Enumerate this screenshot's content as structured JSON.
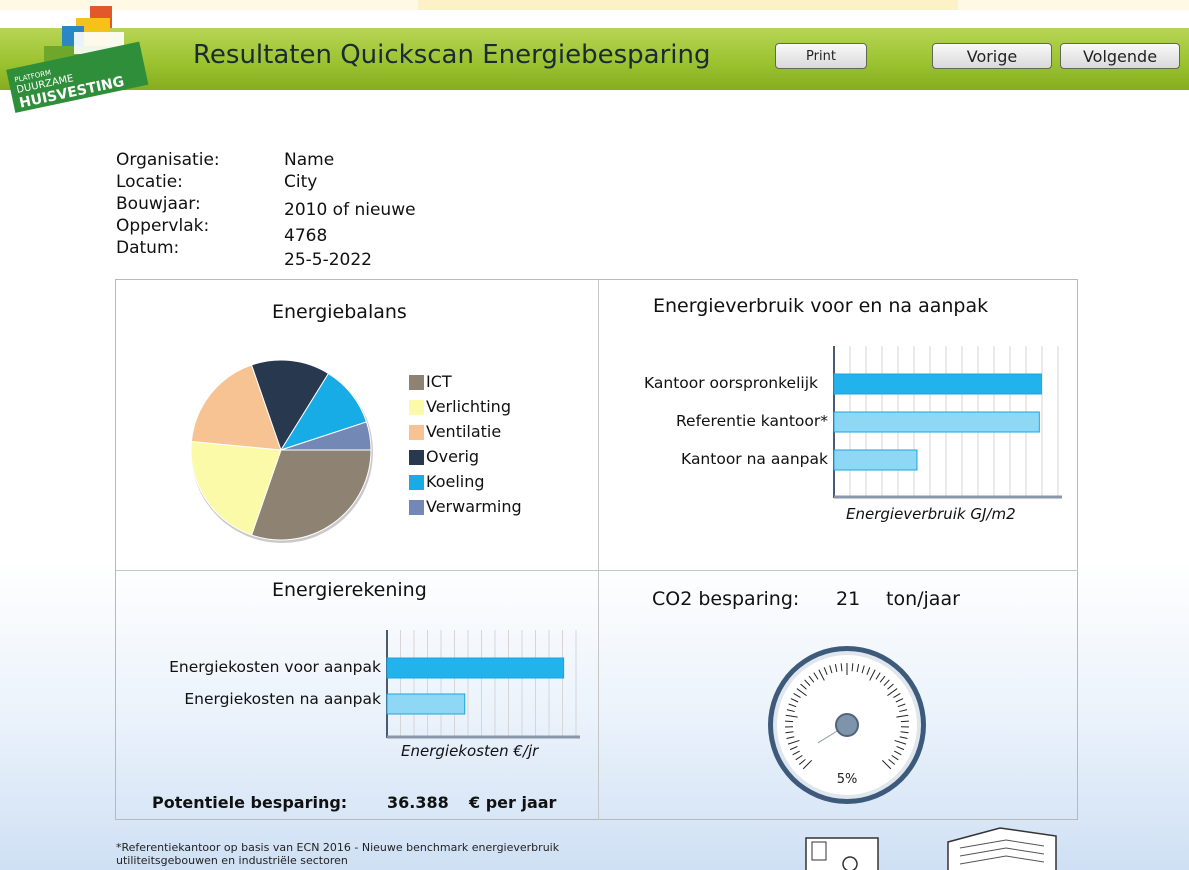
{
  "header": {
    "logo_line1": "PLATFORM",
    "logo_line2": "DUURZAME",
    "logo_line3": "HUISVESTING",
    "title": "Resultaten Quickscan Energiebesparing",
    "print_label": "Print",
    "prev_label": "Vorige",
    "next_label": "Volgende"
  },
  "info": {
    "labels": [
      "Organisatie:",
      "Locatie:",
      "Bouwjaar:",
      "Oppervlak:",
      "Datum:"
    ],
    "values": [
      "Name",
      "City",
      "2010 of nieuwe",
      "4768",
      "25-5-2022"
    ]
  },
  "panels": {
    "energiebalans_title": "Energiebalans",
    "verbruik_title": "Energieverbruik voor en na aanpak",
    "rekening_title": "Energierekening",
    "co2_label": "CO2 besparing:",
    "co2_value": "21",
    "co2_unit": "ton/jaar",
    "gauge_label": "5%",
    "potentiele_label": "Potentiele besparing:",
    "potentiele_value": "36.388",
    "potentiele_unit": "€ per jaar"
  },
  "chart_data": [
    {
      "type": "pie",
      "title": "Energiebalans",
      "legend": [
        "ICT",
        "Verlichting",
        "Ventilatie",
        "Overig",
        "Koeling",
        "Verwarming"
      ],
      "values": [
        30,
        21,
        18,
        14,
        11,
        5
      ],
      "colors": [
        "#8e8373",
        "#fbfaa8",
        "#f8c393",
        "#27384f",
        "#17ace6",
        "#7388b4"
      ]
    },
    {
      "type": "bar",
      "orientation": "horizontal",
      "title": "Energieverbruik voor en na aanpak",
      "categories": [
        "Kantoor oorspronkelijk",
        "Referentie kantoor*",
        "Kantoor na aanpak"
      ],
      "values": [
        100,
        99,
        40
      ],
      "xlabel": "Energieverbruik GJ/m2",
      "xlim": [
        0,
        108
      ],
      "grid": true
    },
    {
      "type": "bar",
      "orientation": "horizontal",
      "title": "Energierekening",
      "categories": [
        "Energiekosten voor aanpak",
        "Energiekosten na aanpak"
      ],
      "values": [
        100,
        44
      ],
      "xlabel": "Energiekosten €/jr",
      "xlim": [
        0,
        107
      ],
      "grid": true
    }
  ],
  "gauge": {
    "value_percent": 5
  },
  "footnote": {
    "line1": "*Referentiekantoor op basis van ECN 2016 - Nieuwe benchmark energieverbruik",
    "line2": "utiliteitsgebouwen en industriële sectoren"
  }
}
